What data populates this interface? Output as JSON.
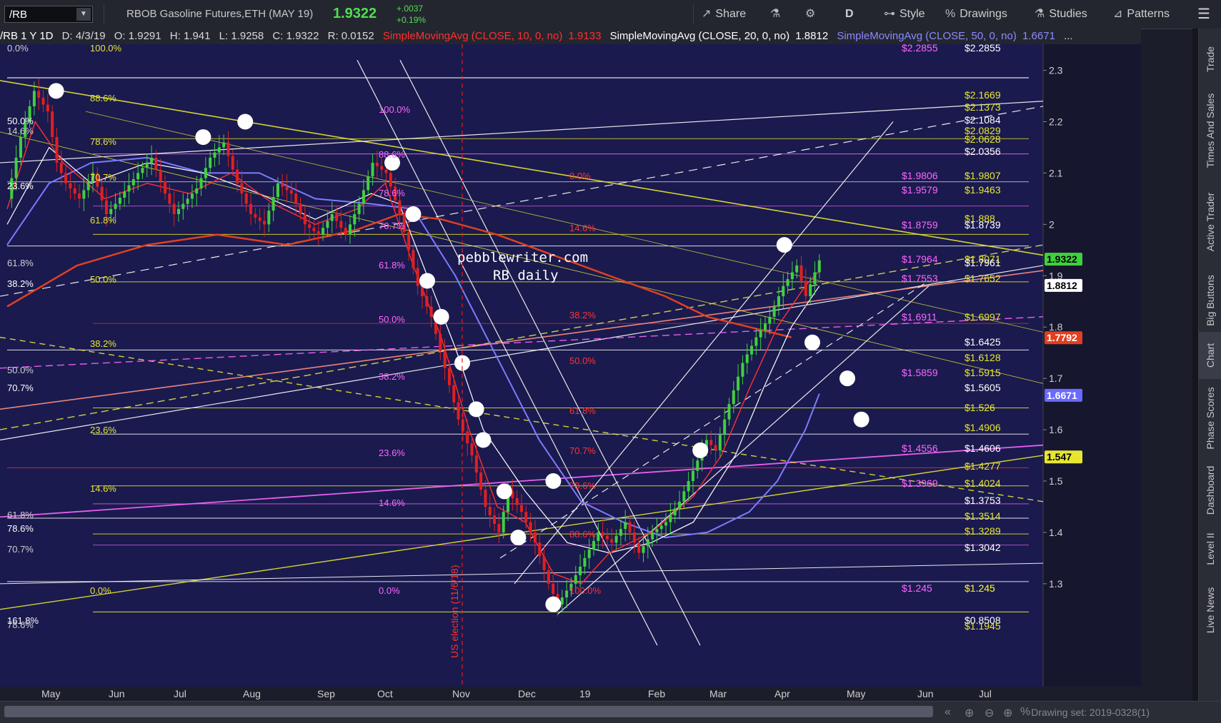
{
  "toolbar": {
    "symbol": "/RB",
    "description": "RBOB Gasoline Futures,ETH (MAY 19)",
    "last": "1.9322",
    "change_abs": "+.0037",
    "change_pct": "+0.19%",
    "buttons": [
      "Share",
      "D",
      "Style",
      "Drawings",
      "Studies",
      "Patterns"
    ],
    "icon_names": [
      "share-icon",
      "flask-icon",
      "gear-icon",
      "style-icon",
      "drawings-icon",
      "studies-icon",
      "patterns-icon",
      "menu-icon"
    ]
  },
  "infobar": {
    "symbol": "/RB 1 Y 1D",
    "date": "D: 4/3/19",
    "open": "O: 1.9291",
    "high": "H: 1.941",
    "low": "L: 1.9258",
    "close": "C: 1.9322",
    "range": "R: 0.0152",
    "sma10": "SimpleMovingAvg (CLOSE, 10, 0, no)",
    "sma10_val": "1.9133",
    "sma20": "SimpleMovingAvg (CLOSE, 20, 0, no)",
    "sma20_val": "1.8812",
    "sma50": "SimpleMovingAvg (CLOSE, 50, 0, no)",
    "sma50_val": "1.6671",
    "more": "..."
  },
  "watermark": [
    "pebblewriter.com",
    "RB daily"
  ],
  "annotation_vertical": "US election (11/6/18)",
  "sidebar_tabs": [
    "Trade",
    "Times And Sales",
    "Active Trader",
    "Big Buttons",
    "Chart",
    "Phase Scores",
    "Dashboard",
    "Level II",
    "Live News"
  ],
  "bottom": {
    "drawing_set": "Drawing set: 2019-0328(1)"
  },
  "colors": {
    "background": "#1a1a4e",
    "up": "#3fd03f",
    "down": "#e02020",
    "sma10": "#ff3030",
    "sma20": "#ffffff",
    "sma50": "#7b7bff",
    "sma_long": "#e04020",
    "fib_yellow": "#e6e632",
    "fib_magenta": "#ff66ff",
    "fib_red": "#ff3333",
    "last_price": "#3fd03f"
  },
  "chart_data": {
    "type": "candlestick",
    "x_ticks": [
      "May",
      "Jun",
      "Jul",
      "Aug",
      "Sep",
      "Oct",
      "Nov",
      "Dec",
      "19",
      "Feb",
      "Mar",
      "Apr",
      "May",
      "Jun",
      "Jul"
    ],
    "y_ticks": [
      "2.3",
      "2.2",
      "2.1",
      "2",
      "1.9",
      "1.8",
      "1.7",
      "1.6",
      "1.5",
      "1.4",
      "1.3"
    ],
    "ylim": [
      1.19,
      2.33
    ],
    "price_path": [
      [
        0,
        2.05
      ],
      [
        2,
        2.17
      ],
      [
        4,
        2.26
      ],
      [
        6,
        2.22
      ],
      [
        7,
        2.12
      ],
      [
        8,
        2.08
      ],
      [
        10,
        2.05
      ],
      [
        12,
        2.1
      ],
      [
        14,
        2.02
      ],
      [
        15,
        2.04
      ],
      [
        18,
        2.1
      ],
      [
        20,
        2.13
      ],
      [
        22,
        2.06
      ],
      [
        23,
        2.02
      ],
      [
        26,
        2.07
      ],
      [
        28,
        2.13
      ],
      [
        30,
        2.16
      ],
      [
        32,
        2.08
      ],
      [
        34,
        2.02
      ],
      [
        36,
        2.0
      ],
      [
        38,
        2.08
      ],
      [
        40,
        2.06
      ],
      [
        42,
        2.0
      ],
      [
        44,
        1.98
      ],
      [
        46,
        2.02
      ],
      [
        48,
        1.98
      ],
      [
        50,
        2.04
      ],
      [
        52,
        2.12
      ],
      [
        54,
        2.1
      ],
      [
        56,
        2.02
      ],
      [
        57,
        1.95
      ],
      [
        58,
        1.88
      ],
      [
        60,
        1.82
      ],
      [
        62,
        1.72
      ],
      [
        64,
        1.62
      ],
      [
        66,
        1.55
      ],
      [
        68,
        1.45
      ],
      [
        70,
        1.4
      ],
      [
        71,
        1.48
      ],
      [
        73,
        1.44
      ],
      [
        75,
        1.38
      ],
      [
        77,
        1.3
      ],
      [
        78,
        1.26
      ],
      [
        80,
        1.3
      ],
      [
        82,
        1.35
      ],
      [
        84,
        1.4
      ],
      [
        86,
        1.38
      ],
      [
        88,
        1.42
      ],
      [
        90,
        1.36
      ],
      [
        92,
        1.4
      ],
      [
        94,
        1.42
      ],
      [
        96,
        1.46
      ],
      [
        98,
        1.52
      ],
      [
        100,
        1.58
      ],
      [
        101,
        1.56
      ],
      [
        103,
        1.65
      ],
      [
        105,
        1.73
      ],
      [
        107,
        1.78
      ],
      [
        109,
        1.82
      ],
      [
        111,
        1.88
      ],
      [
        113,
        1.92
      ],
      [
        114,
        1.86
      ],
      [
        116,
        1.93
      ]
    ],
    "sma_paths": {
      "sma10": [
        [
          0,
          2.03
        ],
        [
          4,
          2.2
        ],
        [
          8,
          2.12
        ],
        [
          14,
          2.05
        ],
        [
          20,
          2.08
        ],
        [
          26,
          2.06
        ],
        [
          32,
          2.1
        ],
        [
          38,
          2.04
        ],
        [
          44,
          2.0
        ],
        [
          50,
          2.03
        ],
        [
          54,
          2.08
        ],
        [
          58,
          1.92
        ],
        [
          62,
          1.78
        ],
        [
          66,
          1.6
        ],
        [
          70,
          1.45
        ],
        [
          74,
          1.42
        ],
        [
          78,
          1.32
        ],
        [
          82,
          1.3
        ],
        [
          86,
          1.36
        ],
        [
          92,
          1.4
        ],
        [
          98,
          1.47
        ],
        [
          102,
          1.55
        ],
        [
          106,
          1.68
        ],
        [
          110,
          1.8
        ],
        [
          114,
          1.88
        ],
        [
          116,
          1.91
        ]
      ],
      "sma20": [
        [
          0,
          2.0
        ],
        [
          6,
          2.15
        ],
        [
          12,
          2.08
        ],
        [
          20,
          2.12
        ],
        [
          28,
          2.1
        ],
        [
          36,
          2.06
        ],
        [
          44,
          2.01
        ],
        [
          52,
          2.06
        ],
        [
          56,
          2.04
        ],
        [
          60,
          1.9
        ],
        [
          64,
          1.76
        ],
        [
          68,
          1.6
        ],
        [
          74,
          1.48
        ],
        [
          80,
          1.38
        ],
        [
          86,
          1.36
        ],
        [
          92,
          1.38
        ],
        [
          98,
          1.42
        ],
        [
          104,
          1.55
        ],
        [
          108,
          1.68
        ],
        [
          112,
          1.8
        ],
        [
          116,
          1.88
        ]
      ],
      "sma50": [
        [
          0,
          1.96
        ],
        [
          6,
          2.08
        ],
        [
          12,
          2.12
        ],
        [
          20,
          2.13
        ],
        [
          28,
          2.1
        ],
        [
          36,
          2.1
        ],
        [
          44,
          2.05
        ],
        [
          52,
          2.04
        ],
        [
          58,
          2.03
        ],
        [
          64,
          1.9
        ],
        [
          70,
          1.74
        ],
        [
          76,
          1.58
        ],
        [
          82,
          1.46
        ],
        [
          88,
          1.42
        ],
        [
          94,
          1.39
        ],
        [
          100,
          1.4
        ],
        [
          106,
          1.44
        ],
        [
          110,
          1.5
        ],
        [
          114,
          1.6
        ],
        [
          116,
          1.67
        ]
      ],
      "sma_long": [
        [
          0,
          1.84
        ],
        [
          10,
          1.92
        ],
        [
          20,
          1.96
        ],
        [
          30,
          1.98
        ],
        [
          40,
          1.96
        ],
        [
          50,
          1.99
        ],
        [
          56,
          2.02
        ],
        [
          62,
          2.01
        ],
        [
          70,
          1.98
        ],
        [
          78,
          1.94
        ],
        [
          86,
          1.9
        ],
        [
          94,
          1.86
        ],
        [
          100,
          1.82
        ],
        [
          106,
          1.8
        ],
        [
          112,
          1.78
        ]
      ]
    },
    "left_fib_labels": [
      "0.0%",
      "50.0%",
      "14.6%",
      "23.6%",
      "61.8%",
      "38.2%",
      "50.0%",
      "70.7%",
      "61.8%",
      "78.6%",
      "70.7%",
      "161.8%",
      "78.6%"
    ],
    "inner_fib_labels": [
      "100.0%",
      "88.6%",
      "78.6%",
      "70.7%",
      "61.8%",
      "50.0%",
      "38.2%",
      "23.6%",
      "14.6%",
      "0.0%",
      "100.0%",
      "88.6%",
      "78.6%",
      "70.7%",
      "61.8%",
      "50.0%",
      "38.2%",
      "23.6%",
      "14.6%",
      "0.0%",
      "0.0%",
      "14.6%",
      "38.2%",
      "50.0%",
      "61.8%",
      "70.7%",
      "78.6%",
      "88.6%",
      "100.0%"
    ],
    "right_labels": [
      [
        "$2.2855",
        "$2.2855"
      ],
      [
        "$2.1669",
        ""
      ],
      [
        "$2.1373",
        ""
      ],
      [
        "$2.1084",
        ""
      ],
      [
        "$2.0829",
        ""
      ],
      [
        "$2.0628",
        ""
      ],
      [
        "$2.0356",
        ""
      ],
      [
        "$1.9807",
        "$1.9806"
      ],
      [
        "$1.9463",
        "$1.9579"
      ],
      [
        "$1.8739",
        "$1.8759"
      ],
      [
        "$1.888",
        ""
      ],
      [
        "$1.8071",
        "$1.7964"
      ],
      [
        "$1.7961",
        ""
      ],
      [
        "$1.7652",
        "$1.7553"
      ],
      [
        "$1.6997",
        "$1.6911"
      ],
      [
        "$1.6425",
        ""
      ],
      [
        "$1.6128",
        ""
      ],
      [
        "$1.5915",
        "$1.5859"
      ],
      [
        "$1.5605",
        ""
      ],
      [
        "$1.526",
        ""
      ],
      [
        "$1.4906",
        ""
      ],
      [
        "$1.4606",
        "$1.4556"
      ],
      [
        "$1.4277",
        ""
      ],
      [
        "$1.4024",
        "$1.3969"
      ],
      [
        "$1.3753",
        ""
      ],
      [
        "$1.3514",
        ""
      ],
      [
        "$1.3289",
        ""
      ],
      [
        "$1.3042",
        ""
      ],
      [
        "$1.245",
        "$1.245"
      ],
      [
        "$1.245",
        ""
      ],
      [
        "$0.8508",
        ""
      ],
      [
        "$1.1945",
        ""
      ]
    ],
    "price_tags": [
      {
        "value": "1.9322",
        "price": 1.9322,
        "color": "#3fd03f"
      },
      {
        "value": "1.8812",
        "price": 1.8812,
        "color": "#ffffff"
      },
      {
        "value": "1.7792",
        "price": 1.7792,
        "color": "#e04020"
      },
      {
        "value": "1.6671",
        "price": 1.6671,
        "color": "#6a6aff"
      },
      {
        "value": "1.547",
        "price": 1.547,
        "color": "#e6e632"
      }
    ]
  }
}
